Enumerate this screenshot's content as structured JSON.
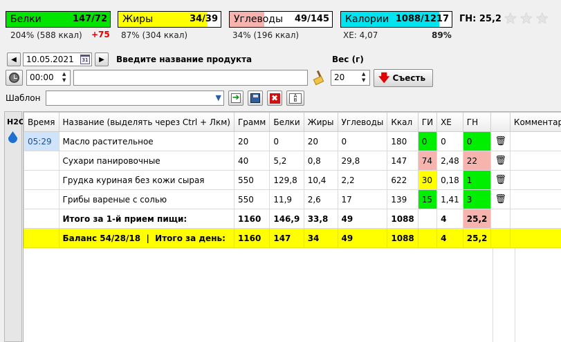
{
  "nutrients": [
    {
      "key": "protein",
      "name": "Белки",
      "value": "147/72",
      "color": "#00e400",
      "fill": 1.0,
      "percent": "204% (588 ккал)",
      "extra": "+75"
    },
    {
      "key": "fat",
      "name": "Жиры",
      "value": "34/39",
      "color": "#ffff00",
      "fill": 0.87,
      "percent": "87% (304 ккал)"
    },
    {
      "key": "carbs",
      "name": "Углеводы",
      "value": "49/145",
      "color": "#f7b3ae",
      "fill": 0.34,
      "percent": "34% (196 ккал)"
    },
    {
      "key": "calories",
      "name": "Калории",
      "value": "1088/1217",
      "color": "#00e4f0",
      "fill": 0.89,
      "xe": "ХЕ: 4,07",
      "percent": "89%"
    }
  ],
  "gn": "ГН: 25,2",
  "rating": {
    "max": 3,
    "value": 0
  },
  "date": "10.05.2021",
  "product_label": "Введите название продукта",
  "weight_label": "Вес (г)",
  "time": "00:00",
  "product_value": "",
  "weight": "20",
  "eat_button": "Съесть",
  "template_label": "Шаблон",
  "template_value": "",
  "side_label": "H2O",
  "table": {
    "headers": [
      "Время",
      "Название (выделять через Ctrl + Лкм)",
      "Грамм",
      "Белки",
      "Жиры",
      "Углеводы",
      "Ккал",
      "ГИ",
      "ХЕ",
      "ГН",
      "",
      "Комментарии"
    ],
    "rows": [
      {
        "time": "05:29",
        "name": "Масло растительное",
        "gram": "20",
        "protein": "0",
        "fat": "20",
        "carbs": "0",
        "kcal": "180",
        "gi": "0",
        "gi_level": "green",
        "xe": "0",
        "gn": "0",
        "gn_level": "green"
      },
      {
        "time": "",
        "name": "Сухари панировочные",
        "gram": "40",
        "protein": "5,2",
        "fat": "0,8",
        "carbs": "29,8",
        "kcal": "147",
        "gi": "74",
        "gi_level": "pink",
        "xe": "2,48",
        "gn": "22",
        "gn_level": "pink"
      },
      {
        "time": "",
        "name": "Грудка куриная без кожи сырая",
        "gram": "550",
        "protein": "129,8",
        "fat": "10,4",
        "carbs": "2,2",
        "kcal": "622",
        "gi": "30",
        "gi_level": "yellow",
        "xe": "0,18",
        "gn": "1",
        "gn_level": "green"
      },
      {
        "time": "",
        "name": "Грибы вареные с солью",
        "gram": "550",
        "protein": "11,9",
        "fat": "2,6",
        "carbs": "17",
        "kcal": "139",
        "gi": "15",
        "gi_level": "green",
        "xe": "1,41",
        "gn": "3",
        "gn_level": "green"
      }
    ],
    "meal_total": {
      "name": "Итого за 1-й прием пищи:",
      "gram": "1160",
      "protein": "146,9",
      "fat": "33,8",
      "carbs": "49",
      "kcal": "1088",
      "xe": "4",
      "gn": "25,2",
      "gn_level": "pink"
    },
    "day_total": {
      "name": "Баланс 54/28/18  |  Итого за день:",
      "gram": "1160",
      "protein": "147",
      "fat": "34",
      "carbs": "49",
      "kcal": "1088",
      "xe": "4",
      "gn": "25,2"
    }
  }
}
